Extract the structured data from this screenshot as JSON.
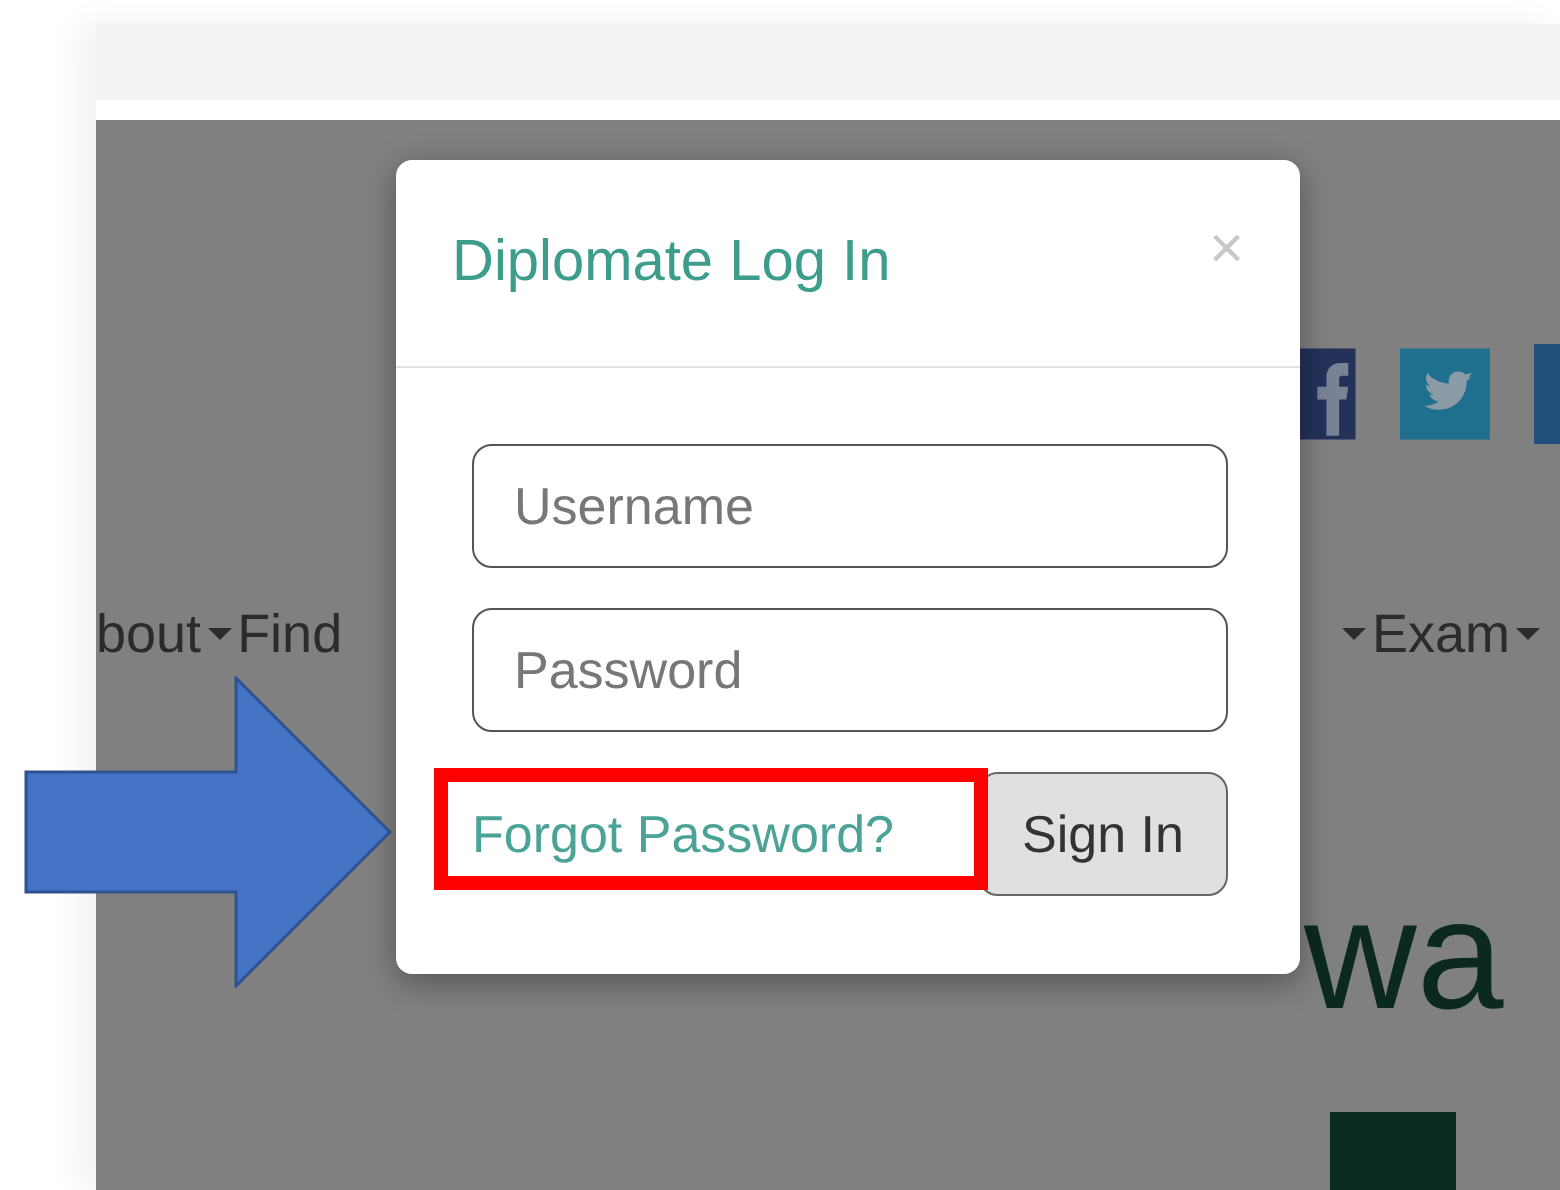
{
  "page": {
    "nav": {
      "left": [
        "bout",
        "Find"
      ],
      "right": [
        "Exam"
      ]
    },
    "heading": "wa"
  },
  "modal": {
    "title": "Diplomate Log In",
    "close": "×",
    "fields": [
      {
        "placeholder": "Username"
      },
      {
        "placeholder": "Password"
      }
    ],
    "forgot_link": "Forgot Password?",
    "sign_in": "Sign In"
  }
}
